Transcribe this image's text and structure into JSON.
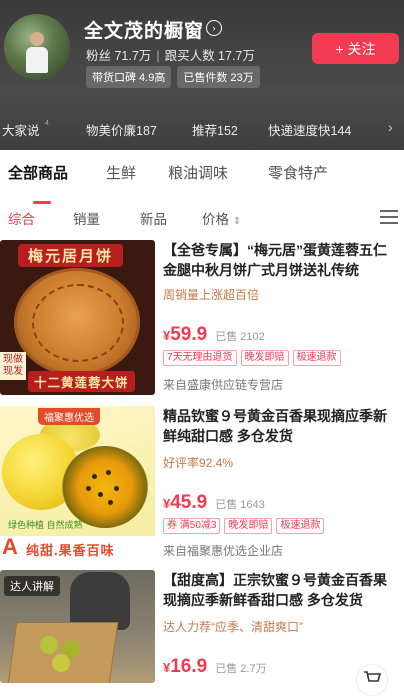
{
  "store": {
    "name": "全文茂的橱窗",
    "stats": {
      "fans": "粉丝 71.7万",
      "buyers": "跟买人数 17.7万"
    },
    "badges": [
      "带货口碑 4.9高",
      "已售件数 23万"
    ],
    "follow_label": "+ 关注",
    "metrics": [
      {
        "label": "大家说",
        "value": "4"
      },
      {
        "label": "物美价廉",
        "value": "187"
      },
      {
        "label": "推荐",
        "value": "152"
      },
      {
        "label": "快递速度快",
        "value": "144"
      }
    ]
  },
  "category_tabs": [
    "全部商品",
    "生鲜",
    "粮油调味",
    "零食特产"
  ],
  "sort_bar": [
    "综合",
    "销量",
    "新品",
    "价格"
  ],
  "products": [
    {
      "title": "【全爸专属】“梅元居”蛋黄莲蓉五仁金腿中秋月饼广式月饼送礼传统",
      "sub": "周销量上涨超百倍",
      "price_currency": "¥",
      "price": "59.9",
      "sold": "已售 2102",
      "tags": [
        "7天无理由退货",
        "晚发即赔",
        "极速退款"
      ],
      "shop": "来自盛康供应链专营店",
      "image_text": {
        "top": "梅元居月饼",
        "bottom": "十二黄莲蓉大饼",
        "side": "现做现发"
      }
    },
    {
      "title": "精品钦蜜９号黄金百香果现摘应季新鲜纯甜口感 多仓发货",
      "sub": "好评率92.4%",
      "price_currency": "¥",
      "price": "45.9",
      "sold": "已售 1643",
      "tags": [
        "券 满50减3",
        "晚发即赔",
        "极速退款"
      ],
      "shop": "来自福聚惠优选企业店",
      "image_text": {
        "top": "福聚惠优选",
        "small": "绿色种植 自然成熟",
        "letter": "A",
        "bottom": "纯甜.果香百味"
      }
    },
    {
      "title": "【甜度高】正宗钦蜜９号黄金百香果现摘应季新鲜香甜口感 多仓发货",
      "sub": "达人力荐“应季、清甜爽口”",
      "price_currency": "¥",
      "price": "16.9",
      "sold": "已售 2.7万",
      "image_text": {
        "label": "达人讲解"
      }
    }
  ],
  "icons": [
    "store-arrow-icon",
    "grid-view-icon",
    "sort-arrows-icon",
    "cart-icon",
    "chevron-right-icon"
  ],
  "colors": {
    "accent": "#f23a52",
    "header_bg": "#3f3f3f",
    "promo_text": "#c6794a"
  }
}
